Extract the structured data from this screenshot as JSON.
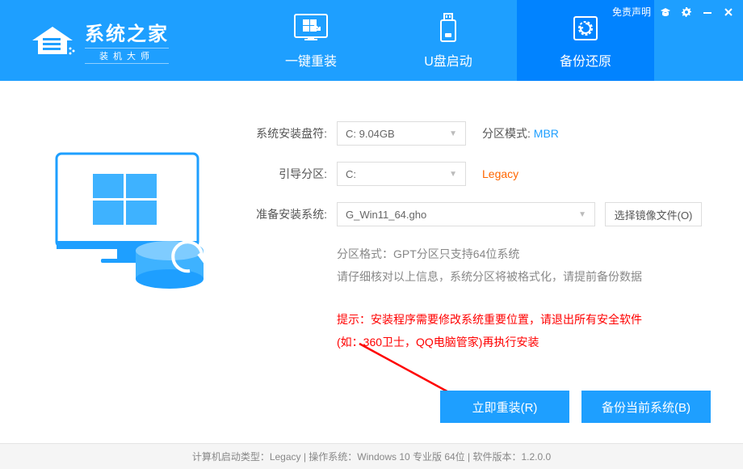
{
  "titlebar": {
    "disclaimer": "免责声明"
  },
  "logo": {
    "title": "系统之家",
    "subtitle": "装机大师"
  },
  "tabs": [
    {
      "label": "一键重装"
    },
    {
      "label": "U盘启动"
    },
    {
      "label": "备份还原"
    }
  ],
  "form": {
    "install_drive_label": "系统安装盘符:",
    "install_drive_value": "C: 9.04GB",
    "partition_mode_label": "分区模式:",
    "partition_mode_value": "MBR",
    "boot_partition_label": "引导分区:",
    "boot_partition_value": "C:",
    "boot_mode_value": "Legacy",
    "prepare_system_label": "准备安装系统:",
    "prepare_system_value": "G_Win11_64.gho",
    "choose_image_btn": "选择镜像文件(O)"
  },
  "info": {
    "line1": "分区格式：GPT分区只支持64位系统",
    "line2": "请仔细核对以上信息，系统分区将被格式化，请提前备份数据"
  },
  "warning": {
    "line1": "提示：安装程序需要修改系统重要位置，请退出所有安全软件",
    "line2": "(如：360卫士，QQ电脑管家)再执行安装"
  },
  "actions": {
    "reinstall": "立即重装(R)",
    "backup": "备份当前系统(B)"
  },
  "status": {
    "text": "计算机启动类型：Legacy | 操作系统：Windows 10 专业版 64位 | 软件版本：1.2.0.0"
  }
}
